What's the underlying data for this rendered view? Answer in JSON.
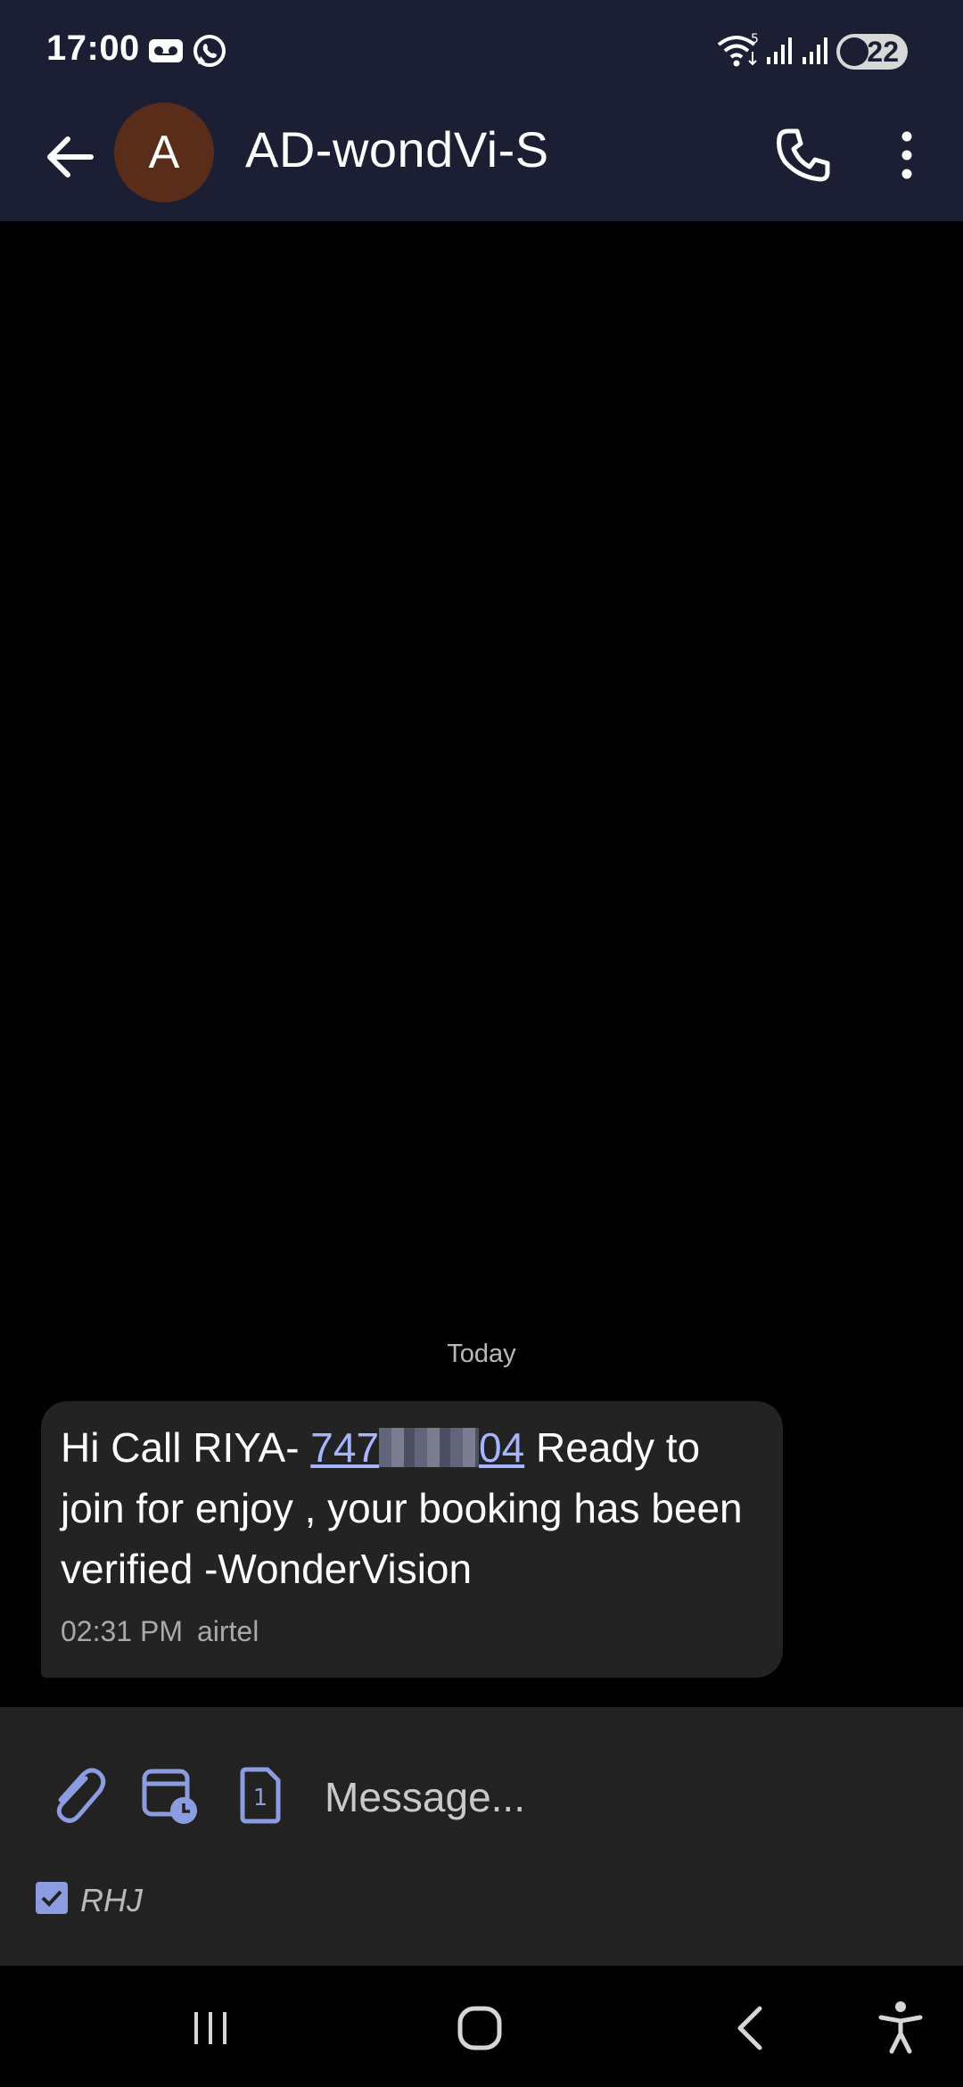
{
  "status_bar": {
    "time": "17:00",
    "battery_level": "22",
    "icons": [
      "voicemail-icon",
      "whatsapp-icon",
      "wifi-icon",
      "signal-icon",
      "signal-icon",
      "battery-icon"
    ]
  },
  "app_bar": {
    "avatar_letter": "A",
    "contact_name": "AD-wondVi-S",
    "icons": [
      "back-arrow-icon",
      "phone-icon",
      "more-vert-icon"
    ]
  },
  "conversation": {
    "date_divider": "Today",
    "messages": [
      {
        "text_before": "Hi Call RIYA- ",
        "phone_prefix": "747",
        "phone_suffix": "04",
        "text_after": " Ready to join for enjoy , your booking has been verified -WonderVision",
        "time": "02:31 PM",
        "carrier": "airtel"
      }
    ]
  },
  "composer": {
    "placeholder": "Message...",
    "value": "",
    "sim_label": "RHJ",
    "sim_checked": true,
    "icons": [
      "attach-icon",
      "schedule-icon",
      "sim-1-icon"
    ]
  },
  "nav_bar": {
    "icons": [
      "recents-icon",
      "home-icon",
      "back-icon",
      "accessibility-icon"
    ]
  },
  "colors": {
    "header_bg": "#1c1e33",
    "link": "#a7b5ff",
    "accent_icon": "#8c9ce0",
    "bubble_bg": "#232323"
  }
}
